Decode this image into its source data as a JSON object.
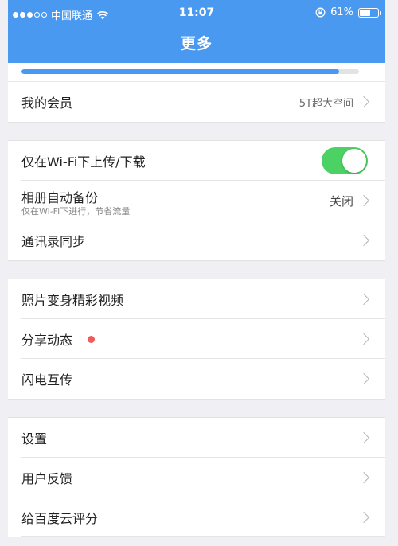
{
  "status_bar": {
    "carrier": "中国联通",
    "signal_dots_filled": 3,
    "signal_dots_total": 5,
    "time": "11:07",
    "battery": "61%",
    "battery_level": 0.61
  },
  "header": {
    "title": "更多",
    "color": "#4a99f0"
  },
  "storage": {
    "used_fraction": 0.94
  },
  "sections": {
    "membership": {
      "label": "我的会员",
      "value": "5T超大空间"
    },
    "wifi_only": {
      "label": "仅在Wi-Fi下上传/下载",
      "enabled": true
    },
    "album_backup": {
      "label": "相册自动备份",
      "subtitle": "仅在Wi-Fi下进行，节省流量",
      "value": "关闭"
    },
    "contacts_sync": {
      "label": "通讯录同步"
    },
    "photo_video": {
      "label": "照片变身精彩视频"
    },
    "share_feed": {
      "label": "分享动态",
      "has_badge": true
    },
    "flash_transfer": {
      "label": "闪电互传"
    },
    "settings": {
      "label": "设置"
    },
    "feedback": {
      "label": "用户反馈"
    },
    "rate": {
      "label": "给百度云评分"
    }
  },
  "colors": {
    "accent": "#4a99f0",
    "toggle_on": "#4cd264",
    "badge": "#f05a5a",
    "background": "#efeff4"
  }
}
